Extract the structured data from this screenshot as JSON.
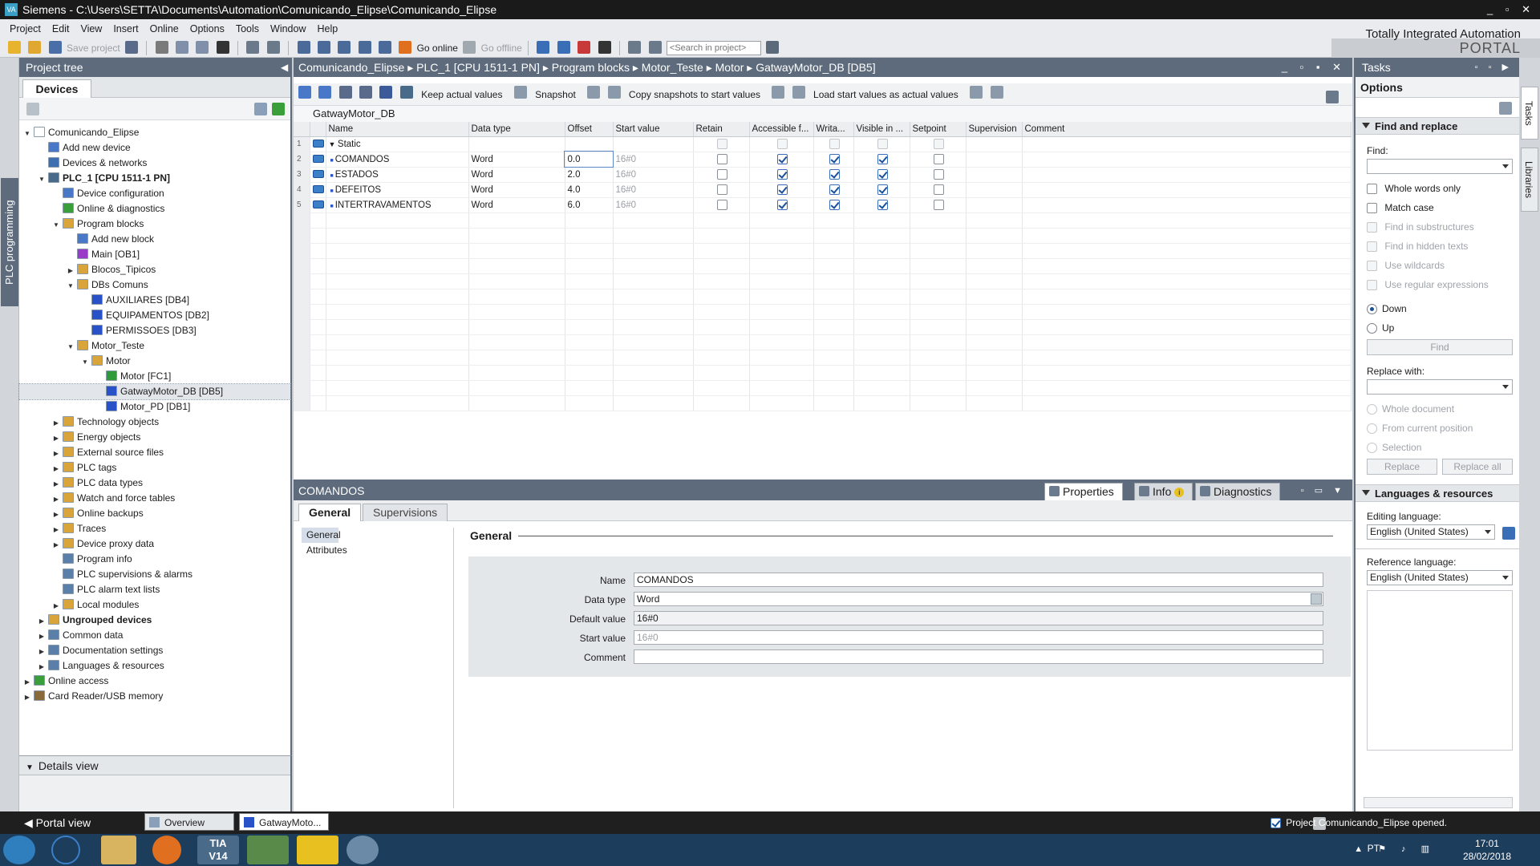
{
  "window": {
    "title": "Siemens  -  C:\\Users\\SETTA\\Documents\\Automation\\Comunicando_Elipse\\Comunicando_Elipse",
    "controls": "_ ▫ ✕"
  },
  "menu": [
    "Project",
    "Edit",
    "View",
    "Insert",
    "Online",
    "Options",
    "Tools",
    "Window",
    "Help"
  ],
  "brand": {
    "line1": "Totally Integrated Automation",
    "line2": "PORTAL"
  },
  "toolbar": {
    "save_project": "Save project",
    "go_online": "Go online",
    "go_offline": "Go offline",
    "search_placeholder": "<Search in project>"
  },
  "left_vertical_tab": "PLC programming",
  "project_tree": {
    "title": "Project tree",
    "tab": "Devices",
    "items": [
      {
        "label": "Comunicando_Elipse",
        "depth": 0,
        "twisty": "open",
        "icon": "project-icon",
        "color": "#ffffff"
      },
      {
        "label": "Add new device",
        "depth": 1,
        "twisty": "",
        "icon": "add-device-icon",
        "color": "#4a78c8"
      },
      {
        "label": "Devices & networks",
        "depth": 1,
        "twisty": "",
        "icon": "network-icon",
        "color": "#3e6fb0"
      },
      {
        "label": "PLC_1 [CPU 1511-1 PN]",
        "depth": 1,
        "twisty": "open",
        "icon": "plc-icon",
        "color": "#4a6a8a",
        "bold": true
      },
      {
        "label": "Device configuration",
        "depth": 2,
        "twisty": "",
        "icon": "device-config-icon",
        "color": "#4a78c8"
      },
      {
        "label": "Online & diagnostics",
        "depth": 2,
        "twisty": "",
        "icon": "diagnostics-icon",
        "color": "#3a9f3a"
      },
      {
        "label": "Program blocks",
        "depth": 2,
        "twisty": "open",
        "icon": "folder-icon",
        "color": "#d9a43a"
      },
      {
        "label": "Add new block",
        "depth": 3,
        "twisty": "",
        "icon": "add-block-icon",
        "color": "#4a78c8"
      },
      {
        "label": "Main [OB1]",
        "depth": 3,
        "twisty": "",
        "icon": "ob-icon",
        "color": "#9a3cc8"
      },
      {
        "label": "Blocos_Tipicos",
        "depth": 3,
        "twisty": "closed",
        "icon": "folder-icon",
        "color": "#d9a43a"
      },
      {
        "label": "DBs Comuns",
        "depth": 3,
        "twisty": "open",
        "icon": "folder-icon",
        "color": "#d9a43a"
      },
      {
        "label": "AUXILIARES [DB4]",
        "depth": 4,
        "twisty": "",
        "icon": "db-icon",
        "color": "#2a52c8"
      },
      {
        "label": "EQUIPAMENTOS [DB2]",
        "depth": 4,
        "twisty": "",
        "icon": "db-icon",
        "color": "#2a52c8"
      },
      {
        "label": "PERMISSOES [DB3]",
        "depth": 4,
        "twisty": "",
        "icon": "db-icon",
        "color": "#2a52c8"
      },
      {
        "label": "Motor_Teste",
        "depth": 3,
        "twisty": "open",
        "icon": "folder-icon",
        "color": "#d9a43a"
      },
      {
        "label": "Motor",
        "depth": 4,
        "twisty": "open",
        "icon": "folder-icon",
        "color": "#d9a43a"
      },
      {
        "label": "Motor [FC1]",
        "depth": 5,
        "twisty": "",
        "icon": "fc-icon",
        "color": "#2f9a3a"
      },
      {
        "label": "GatwayMotor_DB [DB5]",
        "depth": 5,
        "twisty": "",
        "icon": "db-icon",
        "color": "#2a52c8",
        "selected": true
      },
      {
        "label": "Motor_PD [DB1]",
        "depth": 5,
        "twisty": "",
        "icon": "db-icon",
        "color": "#2a52c8"
      },
      {
        "label": "Technology objects",
        "depth": 2,
        "twisty": "closed",
        "icon": "folder-icon",
        "color": "#d9a43a"
      },
      {
        "label": "Energy objects",
        "depth": 2,
        "twisty": "closed",
        "icon": "folder-icon",
        "color": "#d9a43a"
      },
      {
        "label": "External source files",
        "depth": 2,
        "twisty": "closed",
        "icon": "folder-icon",
        "color": "#d9a43a"
      },
      {
        "label": "PLC tags",
        "depth": 2,
        "twisty": "closed",
        "icon": "folder-icon",
        "color": "#d9a43a"
      },
      {
        "label": "PLC data types",
        "depth": 2,
        "twisty": "closed",
        "icon": "folder-icon",
        "color": "#d9a43a"
      },
      {
        "label": "Watch and force tables",
        "depth": 2,
        "twisty": "closed",
        "icon": "folder-icon",
        "color": "#d9a43a"
      },
      {
        "label": "Online backups",
        "depth": 2,
        "twisty": "closed",
        "icon": "folder-icon",
        "color": "#d9a43a"
      },
      {
        "label": "Traces",
        "depth": 2,
        "twisty": "closed",
        "icon": "folder-icon",
        "color": "#d9a43a"
      },
      {
        "label": "Device proxy data",
        "depth": 2,
        "twisty": "closed",
        "icon": "folder-icon",
        "color": "#d9a43a"
      },
      {
        "label": "Program info",
        "depth": 2,
        "twisty": "",
        "icon": "program-info-icon",
        "color": "#5a7fa8"
      },
      {
        "label": "PLC supervisions & alarms",
        "depth": 2,
        "twisty": "",
        "icon": "alarm-icon",
        "color": "#5a7fa8"
      },
      {
        "label": "PLC alarm text lists",
        "depth": 2,
        "twisty": "",
        "icon": "text-list-icon",
        "color": "#5a7fa8"
      },
      {
        "label": "Local modules",
        "depth": 2,
        "twisty": "closed",
        "icon": "folder-icon",
        "color": "#d9a43a"
      },
      {
        "label": "Ungrouped devices",
        "depth": 1,
        "twisty": "closed",
        "icon": "folder-icon",
        "color": "#d9a43a",
        "bold": true
      },
      {
        "label": "Common data",
        "depth": 1,
        "twisty": "closed",
        "icon": "common-data-icon",
        "color": "#5a7fa8"
      },
      {
        "label": "Documentation settings",
        "depth": 1,
        "twisty": "closed",
        "icon": "doc-settings-icon",
        "color": "#5a7fa8"
      },
      {
        "label": "Languages & resources",
        "depth": 1,
        "twisty": "closed",
        "icon": "languages-icon",
        "color": "#5a7fa8"
      },
      {
        "label": "Online access",
        "depth": 0,
        "twisty": "closed",
        "icon": "online-access-icon",
        "color": "#3a9f3a"
      },
      {
        "label": "Card Reader/USB memory",
        "depth": 0,
        "twisty": "closed",
        "icon": "card-reader-icon",
        "color": "#8a6a3a"
      }
    ]
  },
  "details_view": {
    "title": "Details view"
  },
  "editor": {
    "breadcrumb": "Comunicando_Elipse  ▸  PLC_1 [CPU 1511-1 PN]  ▸  Program blocks  ▸  Motor_Teste  ▸  Motor  ▸  GatwayMotor_DB [DB5]",
    "toolbar": {
      "keep_actual": "Keep actual values",
      "snapshot": "Snapshot",
      "copy_snapshots": "Copy snapshots to start values",
      "load_start": "Load start values as actual values"
    },
    "db_name": "GatwayMotor_DB",
    "columns": [
      "",
      "Name",
      "Data type",
      "Offset",
      "Start value",
      "Retain",
      "Accessible f...",
      "Writa...",
      "Visible in ...",
      "Setpoint",
      "Supervision",
      "Comment"
    ],
    "rows": [
      {
        "num": "1",
        "name": "Static",
        "type": "",
        "offset": "",
        "start": "",
        "retain": false,
        "access": false,
        "write": false,
        "visible": false,
        "setpoint": false,
        "header": true
      },
      {
        "num": "2",
        "name": "COMANDOS",
        "type": "Word",
        "offset": "0.0",
        "start": "16#0",
        "retain": false,
        "access": true,
        "write": true,
        "visible": true,
        "setpoint": false
      },
      {
        "num": "3",
        "name": "ESTADOS",
        "type": "Word",
        "offset": "2.0",
        "start": "16#0",
        "retain": false,
        "access": true,
        "write": true,
        "visible": true,
        "setpoint": false
      },
      {
        "num": "4",
        "name": "DEFEITOS",
        "type": "Word",
        "offset": "4.0",
        "start": "16#0",
        "retain": false,
        "access": true,
        "write": true,
        "visible": true,
        "setpoint": false
      },
      {
        "num": "5",
        "name": "INTERTRAVAMENTOS",
        "type": "Word",
        "offset": "6.0",
        "start": "16#0",
        "retain": false,
        "access": true,
        "write": true,
        "visible": true,
        "setpoint": false
      }
    ]
  },
  "inspector": {
    "title": "COMANDOS",
    "tabs": {
      "properties": "Properties",
      "info": "Info",
      "diagnostics": "Diagnostics"
    },
    "subtabs": {
      "general": "General",
      "supervisions": "Supervisions"
    },
    "nav": [
      "General",
      "Attributes"
    ],
    "section": "General",
    "fields": [
      {
        "label": "Name",
        "value": "COMANDOS",
        "ro": false
      },
      {
        "label": "Data type",
        "value": "Word",
        "ro": false
      },
      {
        "label": "Default value",
        "value": "16#0",
        "ro": true
      },
      {
        "label": "Start value",
        "value": "16#0",
        "ro": false,
        "gray": true
      },
      {
        "label": "Comment",
        "value": "",
        "ro": false
      }
    ]
  },
  "tasks": {
    "title": "Tasks",
    "options": "Options",
    "find_replace": "Find and replace",
    "find_label": "Find:",
    "checks": [
      {
        "label": "Whole words only",
        "enabled": true
      },
      {
        "label": "Match case",
        "enabled": true
      },
      {
        "label": "Find in substructures",
        "enabled": false
      },
      {
        "label": "Find in hidden texts",
        "enabled": false
      },
      {
        "label": "Use wildcards",
        "enabled": false
      },
      {
        "label": "Use regular expressions",
        "enabled": false
      }
    ],
    "down": "Down",
    "up": "Up",
    "find_button": "Find",
    "replace_label": "Replace with:",
    "scope": [
      "Whole document",
      "From current position",
      "Selection"
    ],
    "replace_button": "Replace",
    "replace_all_button": "Replace all",
    "lang_section": "Languages & resources",
    "editing_label": "Editing language:",
    "editing_value": "English (United States)",
    "reference_label": "Reference language:",
    "reference_value": "English (United States)"
  },
  "right_tabs": [
    "Tasks",
    "Libraries"
  ],
  "statusbar": {
    "portal_view": "Portal view",
    "tab_overview": "Overview",
    "tab_block": "GatwayMoto...",
    "message": "Project Comunicando_Elipse opened."
  },
  "taskbar": {
    "lang": "PT",
    "time": "17:01",
    "date": "28/02/2018",
    "tia_label": "TIA\nV14"
  }
}
